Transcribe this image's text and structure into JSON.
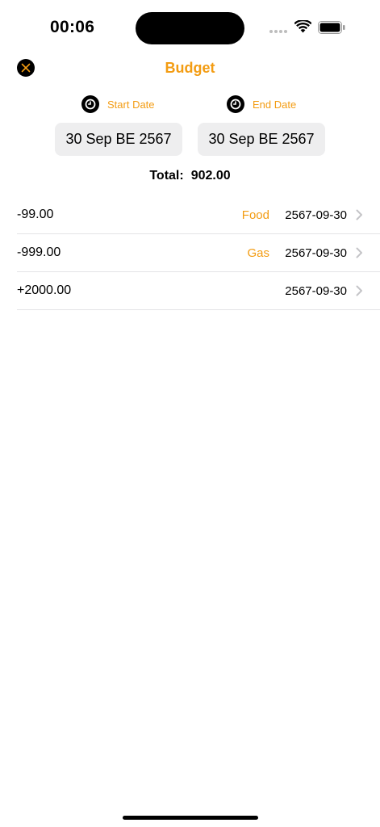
{
  "status_bar": {
    "time": "00:06",
    "icons": [
      "signal-dots-icon",
      "wifi-icon",
      "battery-icon"
    ]
  },
  "nav": {
    "title": "Budget",
    "close_icon": "close-icon"
  },
  "dates": {
    "start_label": "Start Date",
    "end_label": "End Date",
    "start_value": "30 Sep BE 2567",
    "end_value": "30 Sep BE 2567",
    "icon": "clock-icon"
  },
  "total": {
    "label": "Total:",
    "value": "902.00"
  },
  "transactions": [
    {
      "amount": "-99.00",
      "category": "Food",
      "date": "2567-09-30"
    },
    {
      "amount": "-999.00",
      "category": "Gas",
      "date": "2567-09-30"
    },
    {
      "amount": "+2000.00",
      "category": "",
      "date": "2567-09-30"
    }
  ],
  "colors": {
    "accent": "#f39c12",
    "separator": "#e3e3e6",
    "button_bg": "#eeeeef"
  }
}
